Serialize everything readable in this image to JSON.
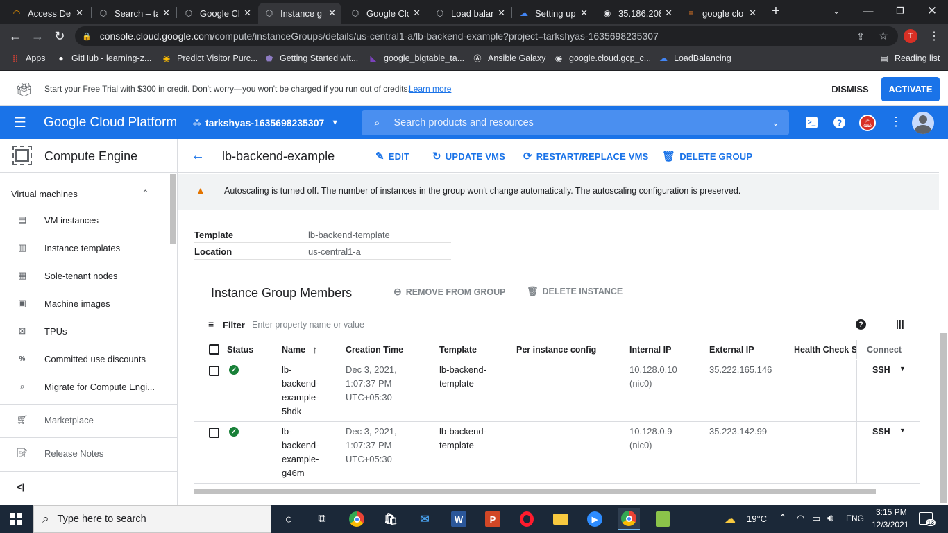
{
  "browser": {
    "tabs": [
      {
        "title": "Access Den",
        "icon": "cloud-shell-icon"
      },
      {
        "title": "Search – ta",
        "icon": "gcp-icon"
      },
      {
        "title": "Google Clo",
        "icon": "gcp-icon"
      },
      {
        "title": "Instance g",
        "icon": "gcp-icon",
        "active": true
      },
      {
        "title": "Google Clo",
        "icon": "gcp-icon"
      },
      {
        "title": "Load balan",
        "icon": "gcp-icon"
      },
      {
        "title": "Setting up",
        "icon": "google-cloud-icon"
      },
      {
        "title": "35.186.208",
        "icon": "globe-icon"
      },
      {
        "title": "google clo",
        "icon": "stackoverflow-icon"
      }
    ],
    "new_tab": "+",
    "url_host": "console.cloud.google.com",
    "url_path": "/compute/instanceGroups/details/us-central1-a/lb-backend-example?project=tarkshyas-1635698235307",
    "profile_initial": "T",
    "bookmarks": [
      {
        "label": "Apps",
        "icon": "apps-grid-icon"
      },
      {
        "label": "GitHub - learning-z...",
        "icon": "github-icon"
      },
      {
        "label": "Predict Visitor Purc...",
        "icon": "bulb-icon"
      },
      {
        "label": "Getting Started wit...",
        "icon": "heroku-icon"
      },
      {
        "label": "google_bigtable_ta...",
        "icon": "terraform-icon"
      },
      {
        "label": "Ansible Galaxy",
        "icon": "ansible-icon"
      },
      {
        "label": "google.cloud.gcp_c...",
        "icon": "globe-icon"
      },
      {
        "label": "LoadBalancing",
        "icon": "google-cloud-icon"
      }
    ],
    "reading_list": "Reading list"
  },
  "trial_banner": {
    "message": "Start your Free Trial with $300 in credit. Don't worry—you won't be charged if you run out of credits.",
    "link": "Learn more",
    "dismiss": "DISMISS",
    "activate": "ACTIVATE"
  },
  "header": {
    "product": "Google Cloud Platform",
    "project": "tarkshyas-1635698235307",
    "search_placeholder": "Search products and resources"
  },
  "sidebar": {
    "title": "Compute Engine",
    "section": "Virtual machines",
    "items": [
      {
        "label": "VM instances",
        "icon": "vm-icon"
      },
      {
        "label": "Instance templates",
        "icon": "template-icon"
      },
      {
        "label": "Sole-tenant nodes",
        "icon": "node-icon"
      },
      {
        "label": "Machine images",
        "icon": "image-icon"
      },
      {
        "label": "TPUs",
        "icon": "tpu-icon"
      },
      {
        "label": "Committed use discounts",
        "icon": "percent-icon"
      },
      {
        "label": "Migrate for Compute Engi...",
        "icon": "search-icon"
      }
    ],
    "marketplace": "Marketplace",
    "release_notes": "Release Notes",
    "collapse": "<|"
  },
  "page": {
    "title": "lb-backend-example",
    "actions": {
      "edit": "EDIT",
      "update": "UPDATE VMS",
      "restart": "RESTART/REPLACE VMS",
      "delete": "DELETE GROUP"
    },
    "warning": "Autoscaling is turned off. The number of instances in the group won't change automatically. The autoscaling configuration is preserved.",
    "details": [
      {
        "key": "Template",
        "value": "lb-backend-template"
      },
      {
        "key": "Location",
        "value": "us-central1-a"
      }
    ],
    "members": {
      "title": "Instance Group Members",
      "remove": "REMOVE FROM GROUP",
      "delete_instance": "DELETE INSTANCE",
      "filter_label": "Filter",
      "filter_placeholder": "Enter property name or value",
      "columns": [
        "Status",
        "Name",
        "Creation Time",
        "Template",
        "Per instance config",
        "Internal IP",
        "External IP",
        "Health Check Sta",
        "Connect"
      ],
      "rows": [
        {
          "name": [
            "lb-",
            "backend-",
            "example-",
            "5hdk"
          ],
          "created": [
            "Dec 3, 2021,",
            "1:07:37 PM",
            "UTC+05:30"
          ],
          "template": [
            "lb-backend-",
            "template"
          ],
          "internal_ip": [
            "10.128.0.10",
            "(nic0)"
          ],
          "external_ip": "35.222.165.146",
          "connect": "SSH"
        },
        {
          "name": [
            "lb-",
            "backend-",
            "example-",
            "g46m"
          ],
          "created": [
            "Dec 3, 2021,",
            "1:07:37 PM",
            "UTC+05:30"
          ],
          "template": [
            "lb-backend-",
            "template"
          ],
          "internal_ip": [
            "10.128.0.9",
            "(nic0)"
          ],
          "external_ip": "35.223.142.99",
          "connect": "SSH"
        }
      ]
    }
  },
  "taskbar": {
    "search_placeholder": "Type here to search",
    "weather": "19°C",
    "language": "ENG",
    "time": "3:15 PM",
    "date": "12/3/2021",
    "notifications": "13"
  },
  "colors": {
    "accent": "#1a73e8",
    "tab_bg": "#202124",
    "toolbar_bg": "#35363a",
    "warning": "#e37400",
    "ok": "#188038",
    "notification": "#d93025"
  }
}
